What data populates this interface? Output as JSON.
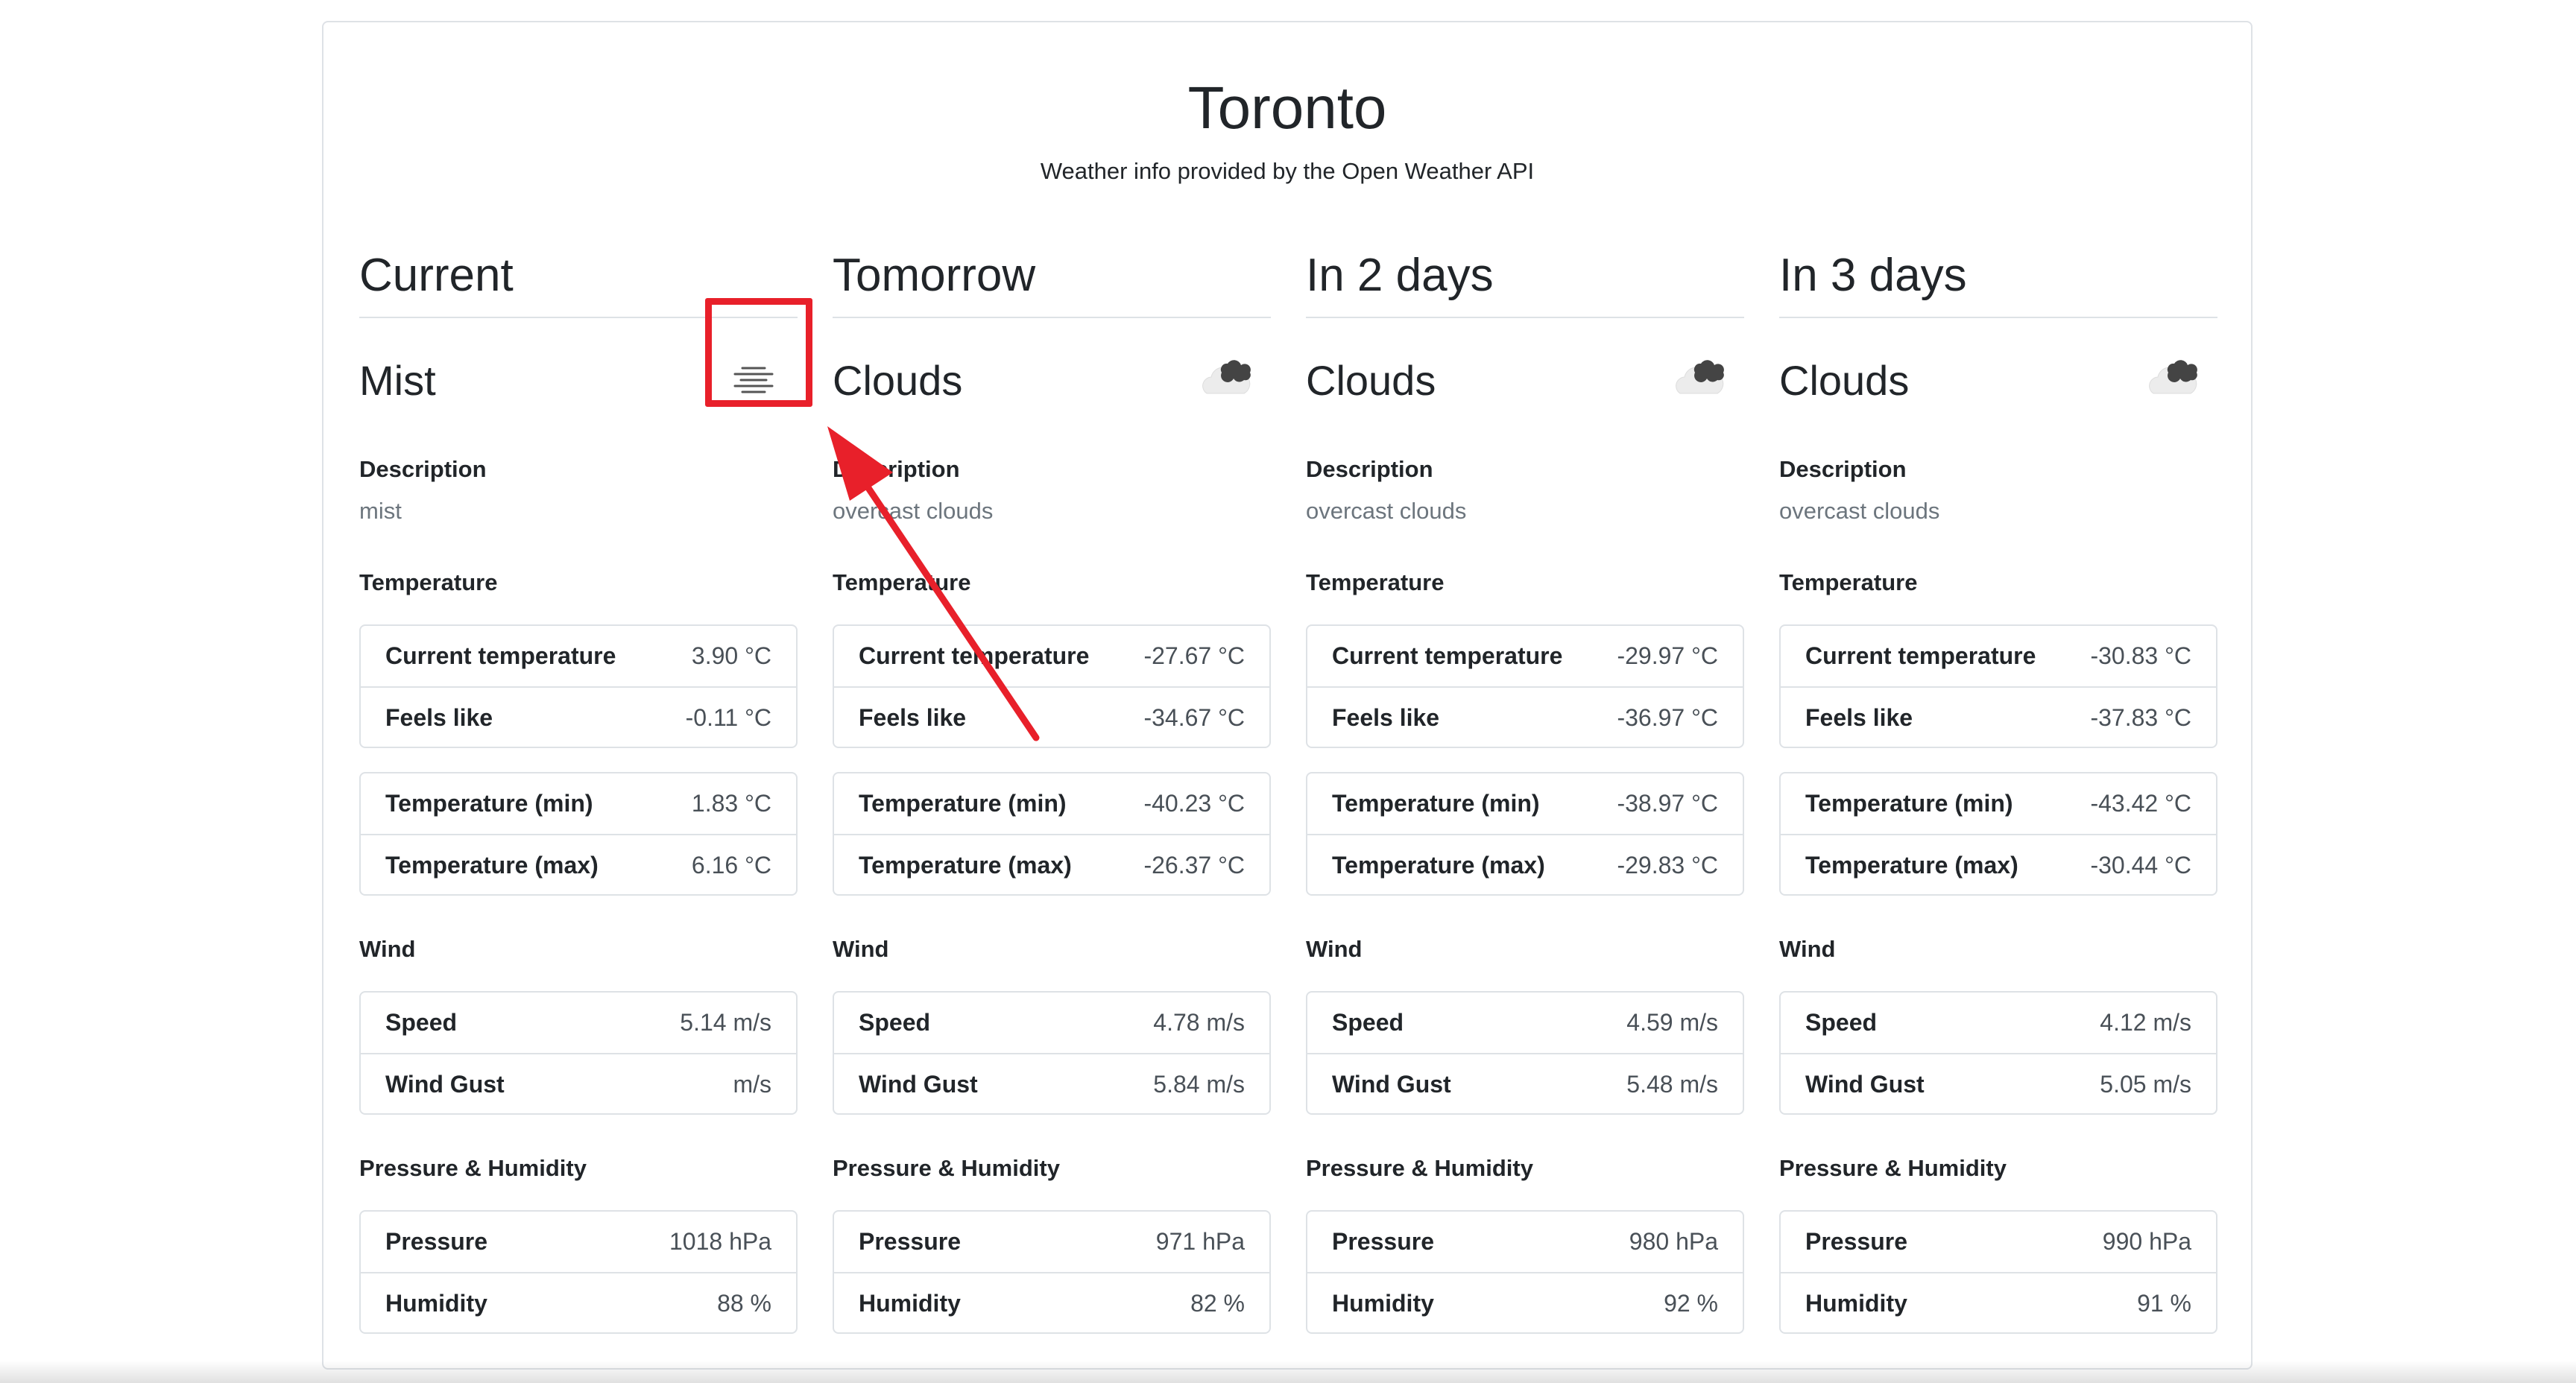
{
  "page": {
    "title": "Toronto",
    "subtitle": "Weather info provided by the Open Weather API"
  },
  "colors": {
    "annotation": "#e8202a",
    "border": "#dee2e6",
    "muted_text": "#6c757d"
  },
  "columns": [
    {
      "heading": "Current",
      "condition": "Mist",
      "icon": "mist-icon",
      "description_label": "Description",
      "description": "mist",
      "temperature_label": "Temperature",
      "current_temperature_label": "Current temperature",
      "current_temperature": "3.90 °C",
      "feels_like_label": "Feels like",
      "feels_like": "-0.11 °C",
      "temp_min_label": "Temperature (min)",
      "temp_min": "1.83 °C",
      "temp_max_label": "Temperature (max)",
      "temp_max": "6.16 °C",
      "wind_label": "Wind",
      "speed_label": "Speed",
      "speed": "5.14 m/s",
      "gust_label": "Wind Gust",
      "gust": "m/s",
      "ph_label": "Pressure & Humidity",
      "pressure_label": "Pressure",
      "pressure": "1018 hPa",
      "humidity_label": "Humidity",
      "humidity": "88 %"
    },
    {
      "heading": "Tomorrow",
      "condition": "Clouds",
      "icon": "clouds-icon",
      "description_label": "Description",
      "description": "overcast clouds",
      "temperature_label": "Temperature",
      "current_temperature_label": "Current temperature",
      "current_temperature": "-27.67 °C",
      "feels_like_label": "Feels like",
      "feels_like": "-34.67 °C",
      "temp_min_label": "Temperature (min)",
      "temp_min": "-40.23 °C",
      "temp_max_label": "Temperature (max)",
      "temp_max": "-26.37 °C",
      "wind_label": "Wind",
      "speed_label": "Speed",
      "speed": "4.78 m/s",
      "gust_label": "Wind Gust",
      "gust": "5.84 m/s",
      "ph_label": "Pressure & Humidity",
      "pressure_label": "Pressure",
      "pressure": "971 hPa",
      "humidity_label": "Humidity",
      "humidity": "82 %"
    },
    {
      "heading": "In 2 days",
      "condition": "Clouds",
      "icon": "clouds-icon",
      "description_label": "Description",
      "description": "overcast clouds",
      "temperature_label": "Temperature",
      "current_temperature_label": "Current temperature",
      "current_temperature": "-29.97 °C",
      "feels_like_label": "Feels like",
      "feels_like": "-36.97 °C",
      "temp_min_label": "Temperature (min)",
      "temp_min": "-38.97 °C",
      "temp_max_label": "Temperature (max)",
      "temp_max": "-29.83 °C",
      "wind_label": "Wind",
      "speed_label": "Speed",
      "speed": "4.59 m/s",
      "gust_label": "Wind Gust",
      "gust": "5.48 m/s",
      "ph_label": "Pressure & Humidity",
      "pressure_label": "Pressure",
      "pressure": "980 hPa",
      "humidity_label": "Humidity",
      "humidity": "92 %"
    },
    {
      "heading": "In 3 days",
      "condition": "Clouds",
      "icon": "clouds-icon",
      "description_label": "Description",
      "description": "overcast clouds",
      "temperature_label": "Temperature",
      "current_temperature_label": "Current temperature",
      "current_temperature": "-30.83 °C",
      "feels_like_label": "Feels like",
      "feels_like": "-37.83 °C",
      "temp_min_label": "Temperature (min)",
      "temp_min": "-43.42 °C",
      "temp_max_label": "Temperature (max)",
      "temp_max": "-30.44 °C",
      "wind_label": "Wind",
      "speed_label": "Speed",
      "speed": "4.12 m/s",
      "gust_label": "Wind Gust",
      "gust": "5.05 m/s",
      "ph_label": "Pressure & Humidity",
      "pressure_label": "Pressure",
      "pressure": "990 hPa",
      "humidity_label": "Humidity",
      "humidity": "91 %"
    }
  ]
}
